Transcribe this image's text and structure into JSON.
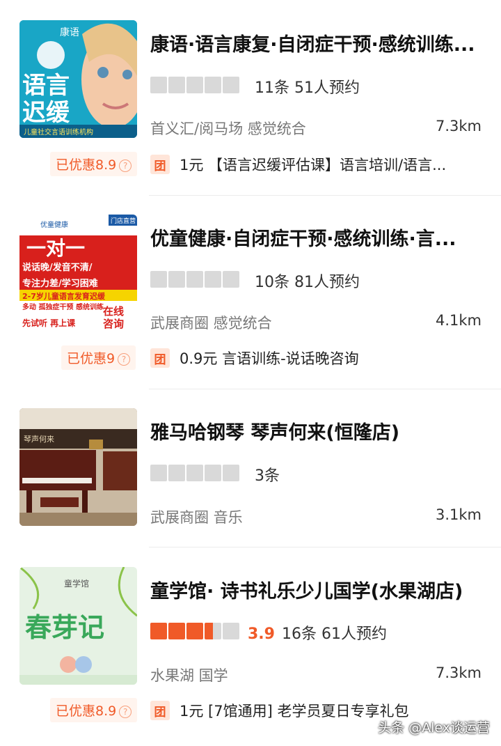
{
  "listings": [
    {
      "title": "康语·语言康复·自闭症干预·感统训练...",
      "meta": "11条  51人预约",
      "location": "首义汇/阅马场 感觉统合",
      "distance": "7.3km",
      "discount": "已优惠8.9",
      "deal": "1元 【语言迟缓评估课】语言培训/语言...",
      "thumb_text": [
        "康语",
        "语言",
        "迟缓",
        "儿童社交言语训练机构"
      ]
    },
    {
      "title": "优童健康·自闭症干预·感统训练·言...",
      "meta": "10条  81人预约",
      "location": "武展商圈 感觉统合",
      "distance": "4.1km",
      "discount": "已优惠9",
      "deal": "0.9元 言语训练-说话晚咨询",
      "thumb_text": [
        "优童健康",
        "门店直营",
        "一对一",
        "说话晚/发音不清/",
        "专注力差/学习困难",
        "2-7岁儿童语言发育迟缓",
        "多动  孤独症干预  感统训练",
        "在线",
        "咨询",
        "先试听 再上课"
      ]
    },
    {
      "title": "雅马哈钢琴 琴声何来(恒隆店)",
      "meta": "3条",
      "location": "武展商圈 音乐",
      "distance": "3.1km",
      "thumb_text": [
        "琴声何来"
      ]
    },
    {
      "title": "童学馆· 诗书礼乐少儿国学(水果湖店)",
      "score": "3.9",
      "rating": 3.5,
      "meta": "16条  61人预约",
      "location": "水果湖 国学",
      "distance": "7.3km",
      "discount": "已优惠8.9",
      "deal": "1元 [7馆通用] 老学员夏日专享礼包",
      "thumb_text": [
        "童学馆",
        "春芽记"
      ]
    }
  ],
  "common": {
    "tuan_label": "团",
    "help_glyph": "?"
  },
  "watermark": "头条 @Alex谈运营",
  "colors": {
    "accent": "#f05a28",
    "star_off": "#d9d9d9",
    "tuan_bg": "#ffe5d9"
  }
}
